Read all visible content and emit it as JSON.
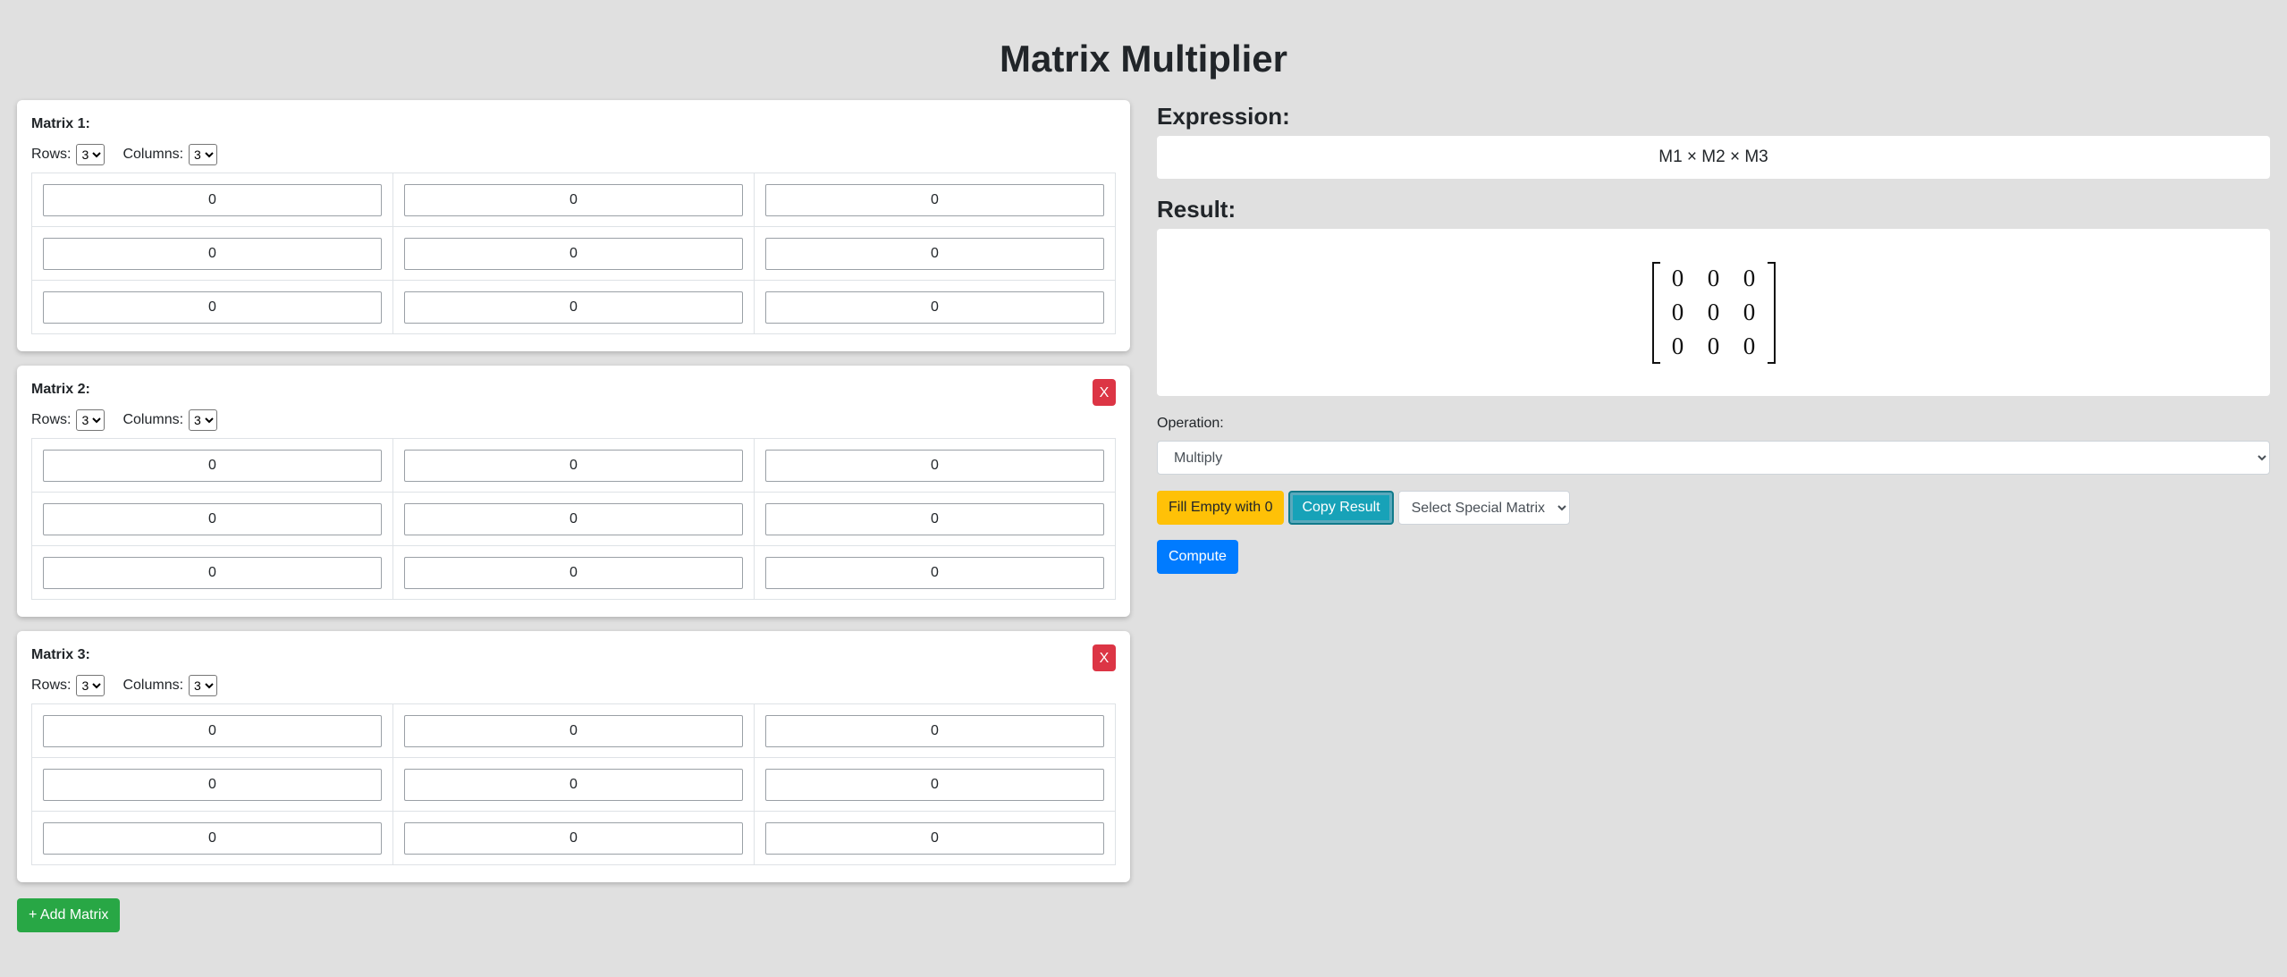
{
  "title": "Matrix Multiplier",
  "matrices": [
    {
      "label": "Matrix 1:",
      "rows_label": "Rows:",
      "cols_label": "Columns:",
      "rows": "3",
      "cols": "3",
      "removable": false,
      "cells": [
        [
          "0",
          "0",
          "0"
        ],
        [
          "0",
          "0",
          "0"
        ],
        [
          "0",
          "0",
          "0"
        ]
      ]
    },
    {
      "label": "Matrix 2:",
      "rows_label": "Rows:",
      "cols_label": "Columns:",
      "rows": "3",
      "cols": "3",
      "removable": true,
      "remove_label": "X",
      "cells": [
        [
          "0",
          "0",
          "0"
        ],
        [
          "0",
          "0",
          "0"
        ],
        [
          "0",
          "0",
          "0"
        ]
      ]
    },
    {
      "label": "Matrix 3:",
      "rows_label": "Rows:",
      "cols_label": "Columns:",
      "rows": "3",
      "cols": "3",
      "removable": true,
      "remove_label": "X",
      "cells": [
        [
          "0",
          "0",
          "0"
        ],
        [
          "0",
          "0",
          "0"
        ],
        [
          "0",
          "0",
          "0"
        ]
      ]
    }
  ],
  "add_matrix_label": "+ Add Matrix",
  "expression": {
    "heading": "Expression:",
    "text": "M1 × M2 × M3"
  },
  "result": {
    "heading": "Result:",
    "cells": [
      [
        "0",
        "0",
        "0"
      ],
      [
        "0",
        "0",
        "0"
      ],
      [
        "0",
        "0",
        "0"
      ]
    ]
  },
  "operation": {
    "label": "Operation:",
    "selected": "Multiply"
  },
  "buttons": {
    "fill_empty": "Fill Empty with 0",
    "copy_result": "Copy Result",
    "special_matrix": "Select Special Matrix",
    "compute": "Compute"
  },
  "colors": {
    "background": "#e0e0e0",
    "danger": "#dc3545",
    "success": "#28a745",
    "warning": "#ffc107",
    "info": "#17a2b8",
    "primary": "#007bff"
  }
}
